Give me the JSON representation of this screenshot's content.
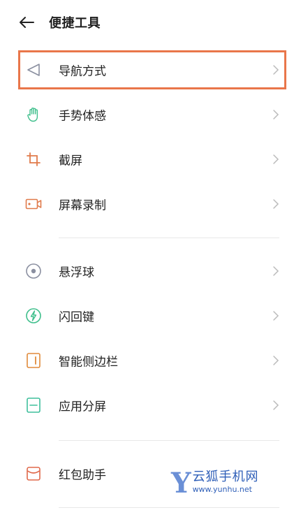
{
  "header": {
    "title": "便捷工具"
  },
  "groups": [
    [
      {
        "label": "导航方式",
        "icon": "navigation-icon"
      },
      {
        "label": "手势体感",
        "icon": "hand-gesture-icon"
      },
      {
        "label": "截屏",
        "icon": "crop-screenshot-icon"
      },
      {
        "label": "屏幕录制",
        "icon": "screen-record-icon"
      }
    ],
    [
      {
        "label": "悬浮球",
        "icon": "floating-ball-icon"
      },
      {
        "label": "闪回键",
        "icon": "flashback-key-icon"
      },
      {
        "label": "智能侧边栏",
        "icon": "smart-sidebar-icon"
      },
      {
        "label": "应用分屏",
        "icon": "split-screen-icon"
      }
    ],
    [
      {
        "label": "红包助手",
        "icon": "red-envelope-icon"
      }
    ]
  ],
  "watermark": {
    "brand": "云狐手机网",
    "url": "www.yunhu.net"
  },
  "colors": {
    "highlight": "#e9764a",
    "green": "#3fbf8c",
    "orange": "#e07a4a",
    "gray": "#8a8fa0"
  }
}
